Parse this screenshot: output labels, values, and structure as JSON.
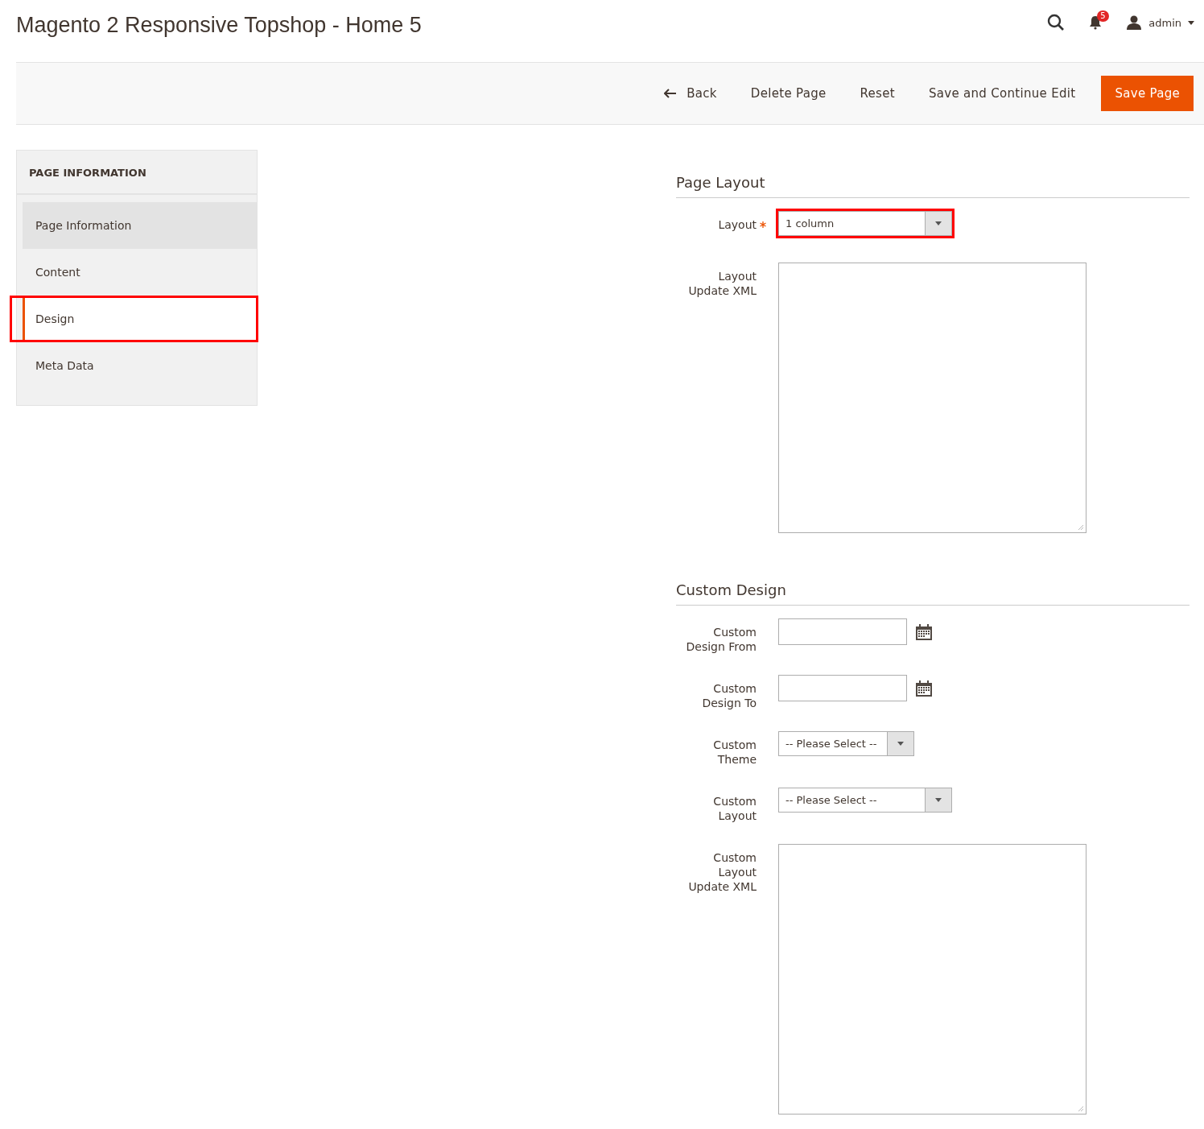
{
  "header": {
    "title": "Magento 2 Responsive Topshop - Home 5",
    "notifications": "5",
    "user": "admin"
  },
  "toolbar": {
    "back": "Back",
    "buttons": [
      {
        "label": "Delete Page",
        "kind": "plain"
      },
      {
        "label": "Reset",
        "kind": "plain"
      },
      {
        "label": "Save and Continue Edit",
        "kind": "plain"
      },
      {
        "label": "Save Page",
        "kind": "primary"
      }
    ]
  },
  "sidebar": {
    "title": "PAGE INFORMATION",
    "items": [
      {
        "label": "Page Information",
        "selected": false,
        "hovered": true,
        "highlighted": false
      },
      {
        "label": "Content",
        "selected": false,
        "hovered": false,
        "highlighted": false
      },
      {
        "label": "Design",
        "selected": true,
        "hovered": false,
        "highlighted": true
      },
      {
        "label": "Meta Data",
        "selected": false,
        "hovered": false,
        "highlighted": false
      }
    ]
  },
  "sections": [
    {
      "title": "Page Layout",
      "fields": [
        {
          "kind": "select",
          "label": "Layout",
          "required": true,
          "value": "1 column",
          "compact": false,
          "highlighted": true
        },
        {
          "kind": "textarea",
          "label": "Layout Update XML",
          "required": false,
          "highlighted": false
        }
      ]
    },
    {
      "title": "Custom Design",
      "fields": [
        {
          "kind": "date",
          "label": "Custom Design From",
          "required": false,
          "highlighted": false
        },
        {
          "kind": "date",
          "label": "Custom Design To",
          "required": false,
          "highlighted": false
        },
        {
          "kind": "select",
          "label": "Custom Theme",
          "required": false,
          "value": "-- Please Select --",
          "compact": true,
          "highlighted": false
        },
        {
          "kind": "select",
          "label": "Custom Layout",
          "required": false,
          "value": "-- Please Select --",
          "compact": false,
          "highlighted": false
        },
        {
          "kind": "textarea",
          "label": "Custom Layout Update XML",
          "required": false,
          "highlighted": false
        }
      ]
    }
  ]
}
